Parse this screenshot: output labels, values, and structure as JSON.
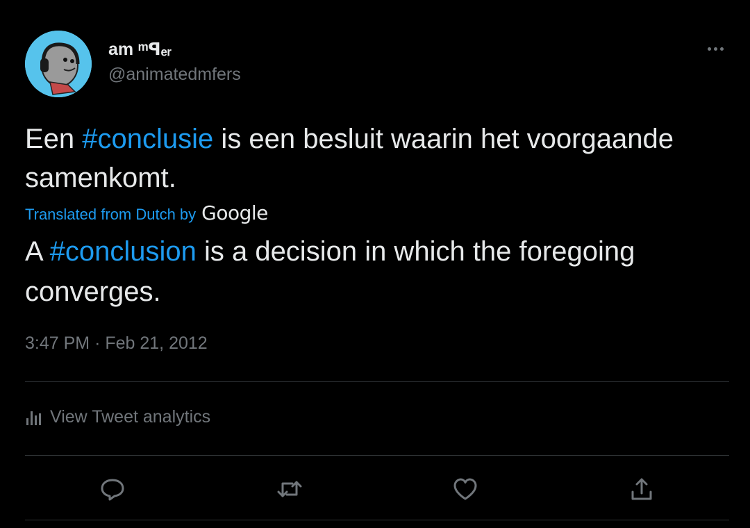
{
  "author": {
    "display_name": "am ᵐꟼₑᵣ",
    "handle": "@animatedmfers"
  },
  "tweet": {
    "original_parts": [
      "Een ",
      "#conclusie",
      " is een besluit waarin het voorgaande samenkomt."
    ],
    "translation_label": "Translated from Dutch by",
    "translation_provider": "Google",
    "translated_parts": [
      "A ",
      "#conclusion",
      " is a decision in which the foregoing converges."
    ],
    "time": "3:47 PM",
    "separator": "·",
    "date": "Feb 21, 2012"
  },
  "analytics": {
    "label": "View Tweet analytics"
  },
  "icons": {
    "more": "more-options-icon",
    "analytics": "analytics-icon",
    "reply": "reply-icon",
    "retweet": "retweet-icon",
    "like": "like-icon",
    "share": "share-icon"
  },
  "colors": {
    "background": "#000000",
    "text": "#e7e9ea",
    "secondary": "#71767b",
    "accent": "#1d9bf0",
    "divider": "#2f3336",
    "avatar_bg": "#56c3ec"
  }
}
